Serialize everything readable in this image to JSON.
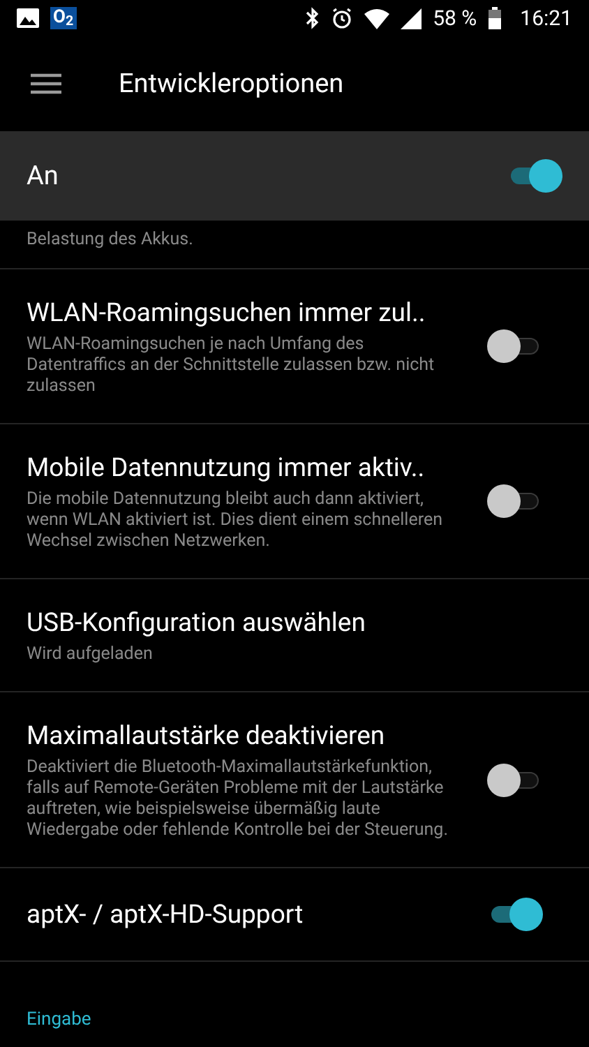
{
  "status_bar": {
    "carrier": "O$_{2}$",
    "battery": "58 %",
    "time": "16:21"
  },
  "toolbar": {
    "title": "Entwickleroptionen"
  },
  "master": {
    "label": "An",
    "on": true
  },
  "partial_summary": "Belastung des Akkus.",
  "settings": [
    {
      "kind": "toggle",
      "title": "WLAN-Roamingsuchen immer zul..",
      "summary": "WLAN-Roamingsuchen je nach Umfang des Datentraffics an der Schnittstelle zulassen bzw. nicht zulassen",
      "on": false
    },
    {
      "kind": "toggle",
      "title": "Mobile Datennutzung immer aktiv..",
      "summary": "Die mobile Datennutzung bleibt auch dann aktiviert, wenn WLAN aktiviert ist. Dies dient einem schnelleren Wechsel zwischen Netzwerken.",
      "on": false
    },
    {
      "kind": "plain",
      "title": "USB-Konfiguration auswählen",
      "summary": "Wird aufgeladen"
    },
    {
      "kind": "toggle",
      "title": "Maximallautstärke deaktivieren",
      "summary": "Deaktiviert die Bluetooth-Maximallautstärkefunktion, falls auf Remote-Geräten Probleme mit der Lautstärke auftreten, wie beispielsweise übermäßig laute Wiedergabe oder fehlende Kontrolle bei der Steuerung.",
      "on": false
    },
    {
      "kind": "toggle",
      "title": "aptX- / aptX-HD-Support",
      "on": true
    }
  ],
  "category": "Eingabe"
}
